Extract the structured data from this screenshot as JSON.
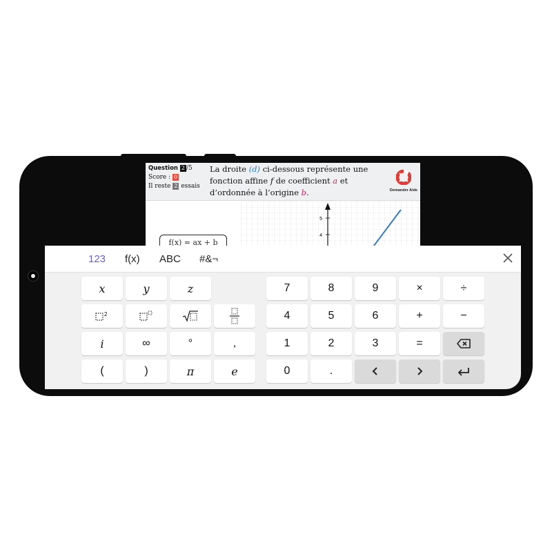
{
  "question": {
    "label": "Question",
    "number": "2",
    "total": "/5",
    "score_label": "Score :",
    "score_value": "0",
    "remaining_prefix": "Il reste",
    "remaining_value": "2",
    "remaining_suffix": "essais"
  },
  "statement": {
    "t1": "La droite ",
    "d": "(d)",
    "t2": " ci-dessous représente une fonction affine ",
    "f": "f",
    "t3": " de coefficient ",
    "a": "a",
    "t4": " et d’ordonnée à l’origine ",
    "b": "b",
    "t5": "."
  },
  "help": {
    "label": "Demander Aide",
    "icon": "lifebuoy-icon"
  },
  "formula": {
    "text": "f(x) = ax + b"
  },
  "graph": {
    "tick_labels": [
      "5",
      "4"
    ]
  },
  "keyboard": {
    "tabs": [
      "123",
      "f(x)",
      "ABC",
      "#&¬"
    ],
    "active_tab": "123",
    "left_keys": [
      "x",
      "y",
      "z",
      "□²",
      "□ⁿ",
      "√□",
      "□/□",
      "i",
      "∞",
      "°",
      ",",
      "(",
      ")",
      "π",
      "e"
    ],
    "right_keys": [
      "7",
      "8",
      "9",
      "×",
      "÷",
      "4",
      "5",
      "6",
      "+",
      "−",
      "1",
      "2",
      "3",
      "=",
      "⌫",
      "0",
      ".",
      "‹",
      "›",
      "↵"
    ]
  },
  "colors": {
    "accent": "#6b5fd3",
    "line_blue": "#2f7dc0",
    "pink": "#d81b60",
    "score_red": "#e74c3c"
  }
}
